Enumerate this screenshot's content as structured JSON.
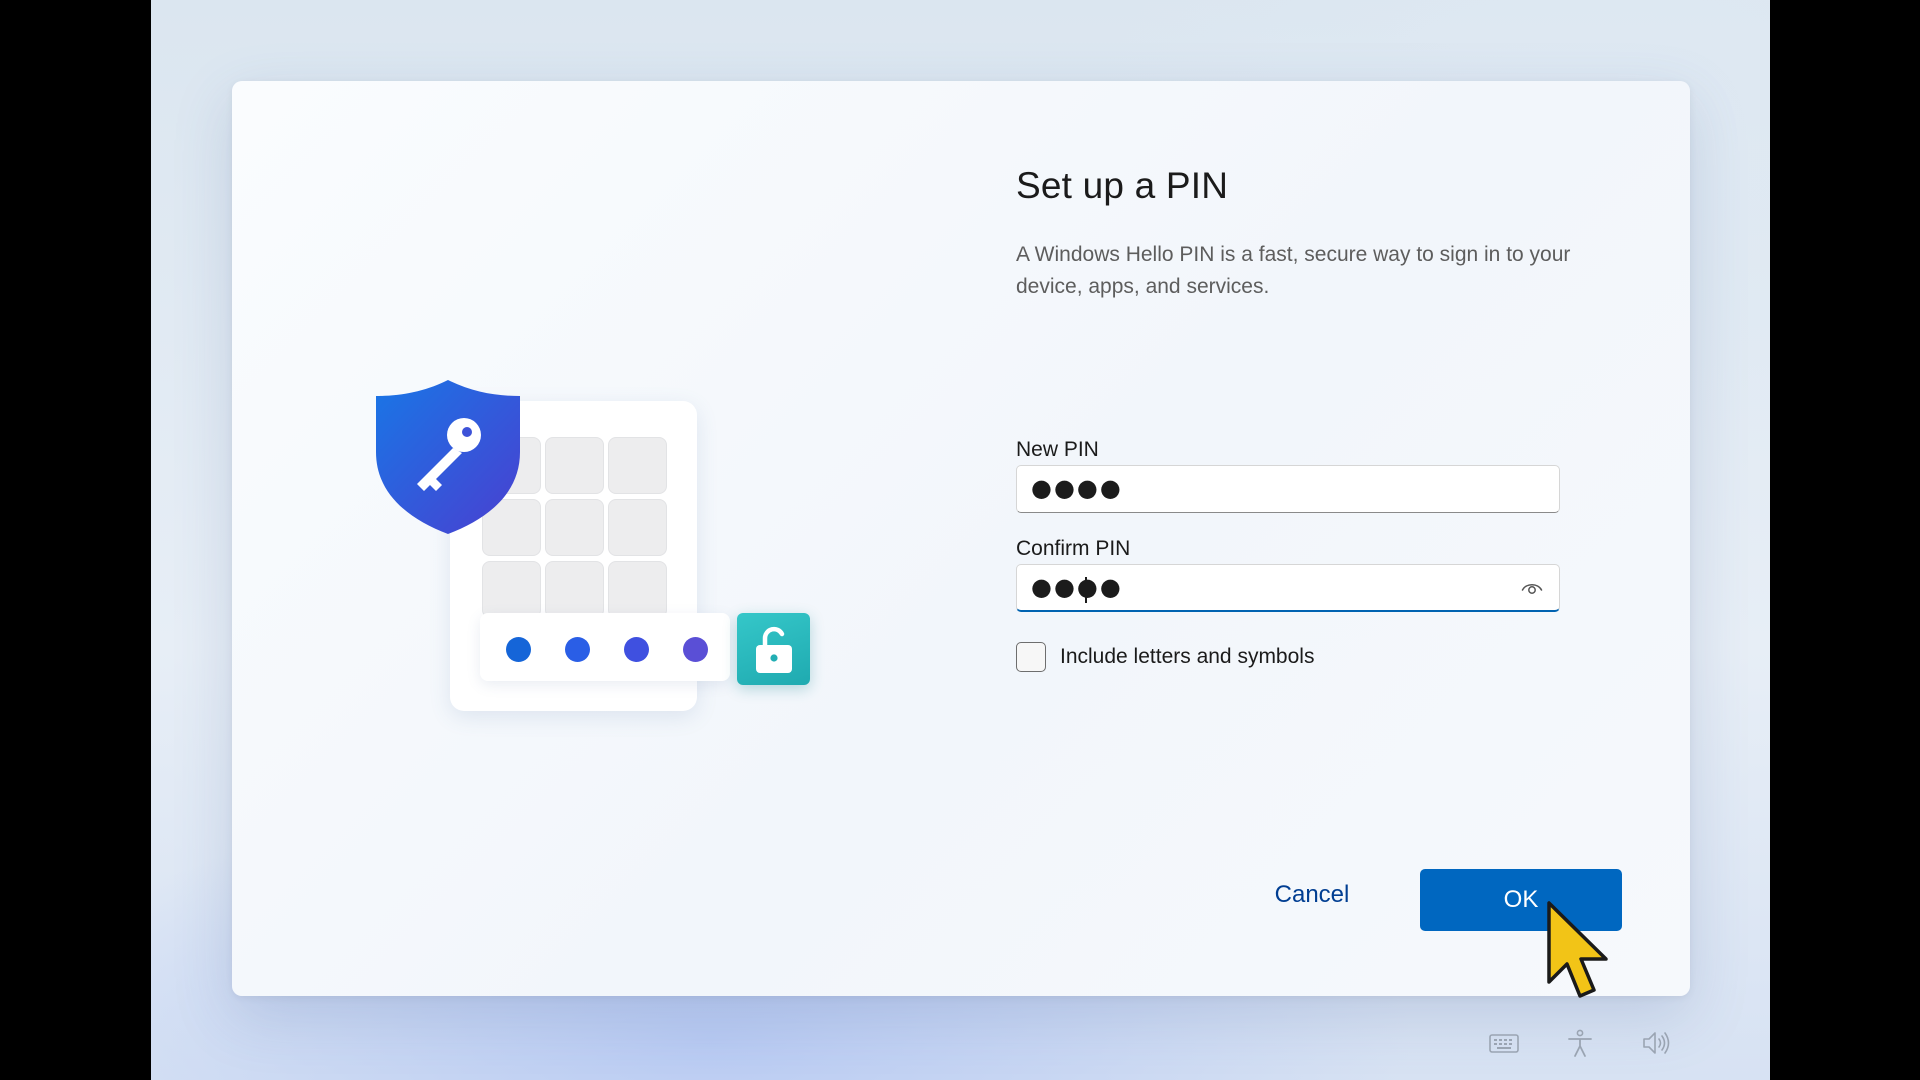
{
  "dialog": {
    "title": "Set up a PIN",
    "description": "A Windows Hello PIN is a fast, secure way to sign in to your device, apps, and services."
  },
  "new_pin": {
    "label": "New PIN",
    "masked_value": "●●●●"
  },
  "confirm_pin": {
    "label": "Confirm PIN",
    "masked_value": "●●●●",
    "focused": true
  },
  "include_letters": {
    "label": "Include letters and symbols",
    "checked": false
  },
  "buttons": {
    "cancel": "Cancel",
    "ok": "OK"
  },
  "illustration": {
    "shield_icon": "shield-key-icon",
    "lock_icon": "unlock-icon",
    "pin_dot_colors": [
      "#1565d8",
      "#2a5ee6",
      "#3f50e0",
      "#5a4fd6"
    ],
    "accent_teal": "#2bb9bd"
  },
  "tray": {
    "icons": [
      "keyboard-icon",
      "accessibility-icon",
      "volume-icon"
    ]
  },
  "colors": {
    "primary_button": "#0067c0",
    "cancel_text": "#003e92",
    "focus_underline": "#0063b1"
  }
}
